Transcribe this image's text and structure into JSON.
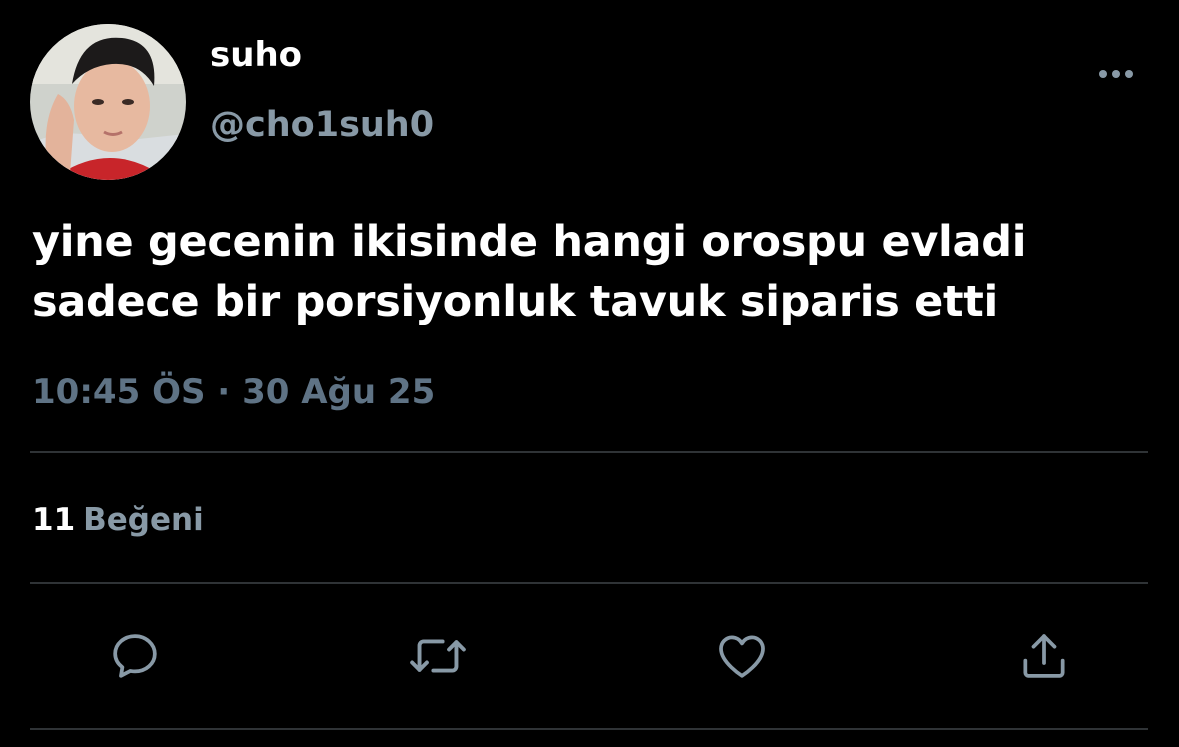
{
  "tweet": {
    "display_name": "suho",
    "handle": "@cho1suh0",
    "text_lines": [
      "yine gecenin ikisinde hangi orospu evladi",
      "sadece bir porsiyonluk tavuk siparis etti"
    ],
    "time": "10:45 ÖS",
    "separator": "·",
    "date": "30 Ağu 25"
  },
  "stats": {
    "likes_count": "11",
    "likes_label": "Beğeni"
  },
  "actions": {
    "reply_icon": "reply-icon",
    "retweet_icon": "retweet-icon",
    "like_icon": "heart-icon",
    "share_icon": "share-icon"
  },
  "colors": {
    "background": "#000000",
    "primary_text": "#ffffff",
    "secondary_text": "#8899a6",
    "divider": "#2f3336"
  }
}
